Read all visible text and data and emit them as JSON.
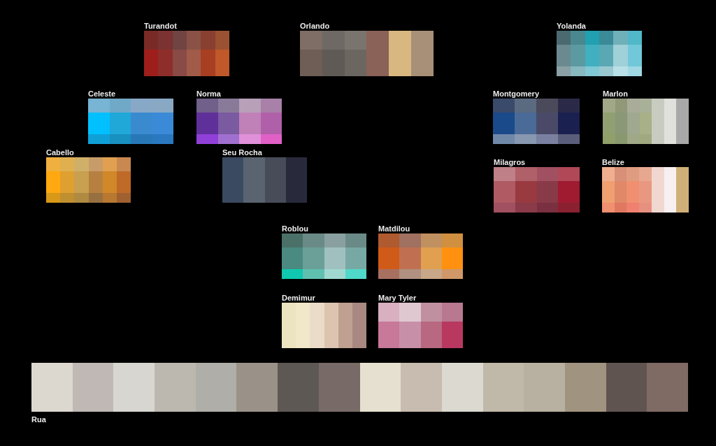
{
  "palettes": [
    {
      "name": "Turandot",
      "columns": [
        {
          "cells": [
            {
              "color": "#7a2a26"
            },
            {
              "color": "#9e1e1c"
            }
          ]
        },
        {
          "cells": [
            {
              "color": "#7c3230"
            },
            {
              "color": "#8e2e2a"
            }
          ]
        },
        {
          "cells": [
            {
              "color": "#6f4442"
            },
            {
              "color": "#8a4a46"
            }
          ]
        },
        {
          "cells": [
            {
              "color": "#8a5246"
            },
            {
              "color": "#a05c48"
            }
          ]
        },
        {
          "cells": [
            {
              "color": "#8a4030"
            },
            {
              "color": "#a83e22"
            }
          ]
        },
        {
          "cells": [
            {
              "color": "#9a5232"
            },
            {
              "color": "#c0582a"
            }
          ]
        }
      ]
    },
    {
      "name": "Orlando",
      "columns": [
        {
          "cells": [
            {
              "color": "#7e6e66"
            },
            {
              "color": "#6e5e56"
            }
          ]
        },
        {
          "cells": [
            {
              "color": "#6e6964"
            },
            {
              "color": "#5f5a56"
            }
          ]
        },
        {
          "cells": [
            {
              "color": "#7a746f"
            },
            {
              "color": "#6c6661"
            }
          ]
        },
        {
          "cells": [
            {
              "color": "#8a6258"
            }
          ]
        },
        {
          "cells": [
            {
              "color": "#d8b880"
            }
          ]
        },
        {
          "cells": [
            {
              "color": "#a89078"
            }
          ]
        }
      ]
    },
    {
      "name": "Yolanda",
      "columns": [
        {
          "cells": [
            {
              "color": "#4a6a70"
            },
            {
              "color": "#6a8a90"
            },
            {
              "color": "#8aa0a4"
            }
          ]
        },
        {
          "cells": [
            {
              "color": "#4a8890"
            },
            {
              "color": "#5a9aa0"
            },
            {
              "color": "#88b8c0"
            }
          ]
        },
        {
          "cells": [
            {
              "color": "#20a0b0"
            },
            {
              "color": "#40b0c0"
            },
            {
              "color": "#80c8d4"
            }
          ]
        },
        {
          "cells": [
            {
              "color": "#3a8a98"
            },
            {
              "color": "#5aa8b4"
            },
            {
              "color": "#9ac8d0"
            }
          ]
        },
        {
          "cells": [
            {
              "color": "#70b0b8"
            },
            {
              "color": "#a0d0d8"
            },
            {
              "color": "#b8e0e6"
            }
          ]
        },
        {
          "cells": [
            {
              "color": "#50b8c8"
            },
            {
              "color": "#70c8d8"
            },
            {
              "color": "#a0d8e4"
            }
          ]
        }
      ]
    },
    {
      "name": "Celeste",
      "columns": [
        {
          "cells": [
            {
              "color": "#78b4d4"
            },
            {
              "color": "#00c0ff"
            },
            {
              "color": "#10a0d8"
            }
          ]
        },
        {
          "cells": [
            {
              "color": "#70a8c8"
            },
            {
              "color": "#20a8d8"
            },
            {
              "color": "#1890c0"
            }
          ]
        },
        {
          "cells": [
            {
              "color": "#88a8c8"
            },
            {
              "color": "#3a8ad0"
            },
            {
              "color": "#2878b8"
            }
          ]
        },
        {
          "cells": [
            {
              "color": "#88a8c4"
            },
            {
              "color": "#3a8ad8"
            },
            {
              "color": "#2a78c0"
            }
          ]
        }
      ]
    },
    {
      "name": "Norma",
      "columns": [
        {
          "cells": [
            {
              "color": "#70608a"
            },
            {
              "color": "#60309a"
            },
            {
              "color": "#9040d8"
            }
          ]
        },
        {
          "cells": [
            {
              "color": "#8a7a9a"
            },
            {
              "color": "#7a5aa0"
            },
            {
              "color": "#a070d0"
            }
          ]
        },
        {
          "cells": [
            {
              "color": "#b8a0b8"
            },
            {
              "color": "#c080b8"
            },
            {
              "color": "#e090d8"
            }
          ]
        },
        {
          "cells": [
            {
              "color": "#a880a8"
            },
            {
              "color": "#b060a8"
            },
            {
              "color": "#e060c8"
            }
          ]
        }
      ]
    },
    {
      "name": "Montgomery",
      "columns": [
        {
          "cells": [
            {
              "color": "#3a4a6a"
            },
            {
              "color": "#1a4a8a"
            },
            {
              "color": "#7088a8"
            }
          ]
        },
        {
          "cells": [
            {
              "color": "#5a6a80"
            },
            {
              "color": "#4a6a98"
            },
            {
              "color": "#8898b0"
            }
          ]
        },
        {
          "cells": [
            {
              "color": "#4a4a5a"
            },
            {
              "color": "#4a4a68"
            },
            {
              "color": "#7a80a0"
            }
          ]
        },
        {
          "cells": [
            {
              "color": "#2a2a48"
            },
            {
              "color": "#1a2050"
            },
            {
              "color": "#5a5e7a"
            }
          ]
        }
      ]
    },
    {
      "name": "Marlon",
      "columns": [
        {
          "cells": [
            {
              "color": "#a0a888"
            },
            {
              "color": "#90a070"
            },
            {
              "color": "#90a068"
            }
          ]
        },
        {
          "cells": [
            {
              "color": "#909878"
            },
            {
              "color": "#8a9878"
            },
            {
              "color": "#8a9870"
            }
          ]
        },
        {
          "cells": [
            {
              "color": "#a8ac98"
            },
            {
              "color": "#a0a890"
            },
            {
              "color": "#a0a888"
            }
          ]
        },
        {
          "cells": [
            {
              "color": "#a8b098"
            },
            {
              "color": "#a8b088"
            },
            {
              "color": "#a0a880"
            }
          ]
        },
        {
          "cells": [
            {
              "color": "#c8ccc0"
            }
          ]
        },
        {
          "cells": [
            {
              "color": "#e0e0dc"
            }
          ]
        },
        {
          "cells": [
            {
              "color": "#a8a8a8"
            }
          ]
        }
      ]
    },
    {
      "name": "Cabello",
      "columns": [
        {
          "cells": [
            {
              "color": "#f0b040"
            },
            {
              "color": "#ffa810"
            },
            {
              "color": "#d89818"
            }
          ]
        },
        {
          "cells": [
            {
              "color": "#e0b050"
            },
            {
              "color": "#e0a030"
            },
            {
              "color": "#c09030"
            }
          ]
        },
        {
          "cells": [
            {
              "color": "#d0b068"
            },
            {
              "color": "#c8a050"
            },
            {
              "color": "#b08a40"
            }
          ]
        },
        {
          "cells": [
            {
              "color": "#c89c68"
            },
            {
              "color": "#b88040"
            },
            {
              "color": "#987040"
            }
          ]
        },
        {
          "cells": [
            {
              "color": "#e0a050"
            },
            {
              "color": "#d08828"
            },
            {
              "color": "#b87830"
            }
          ]
        },
        {
          "cells": [
            {
              "color": "#c88850"
            },
            {
              "color": "#c06a28"
            },
            {
              "color": "#a06030"
            }
          ]
        }
      ]
    },
    {
      "name": "Seu Rocha",
      "columns": [
        {
          "cells": [
            {
              "color": "#3a4a60"
            }
          ]
        },
        {
          "cells": [
            {
              "color": "#5a6470"
            }
          ]
        },
        {
          "cells": [
            {
              "color": "#484c58"
            }
          ]
        },
        {
          "cells": [
            {
              "color": "#282a3c"
            }
          ]
        }
      ]
    },
    {
      "name": "Milagros",
      "columns": [
        {
          "cells": [
            {
              "color": "#c08088"
            },
            {
              "color": "#b05a64"
            },
            {
              "color": "#a05060"
            }
          ]
        },
        {
          "cells": [
            {
              "color": "#b06068"
            },
            {
              "color": "#983a40"
            },
            {
              "color": "#8a3a48"
            }
          ]
        },
        {
          "cells": [
            {
              "color": "#a05060"
            },
            {
              "color": "#883a48"
            },
            {
              "color": "#7a3040"
            }
          ]
        },
        {
          "cells": [
            {
              "color": "#b04858"
            },
            {
              "color": "#a01a30"
            },
            {
              "color": "#8a2030"
            }
          ]
        }
      ]
    },
    {
      "name": "Belize",
      "columns": [
        {
          "cells": [
            {
              "color": "#f0b090"
            },
            {
              "color": "#f0a070"
            },
            {
              "color": "#f09070"
            }
          ]
        },
        {
          "cells": [
            {
              "color": "#d89078"
            },
            {
              "color": "#e08868"
            },
            {
              "color": "#e07860"
            }
          ]
        },
        {
          "cells": [
            {
              "color": "#e09c80"
            },
            {
              "color": "#f09070"
            },
            {
              "color": "#f08070"
            }
          ]
        },
        {
          "cells": [
            {
              "color": "#e8a890"
            },
            {
              "color": "#e89880"
            },
            {
              "color": "#e89080"
            }
          ]
        },
        {
          "cells": [
            {
              "color": "#f0d8d0"
            }
          ]
        },
        {
          "cells": [
            {
              "color": "#f8f0f0"
            }
          ]
        },
        {
          "cells": [
            {
              "color": "#d0b078"
            }
          ]
        }
      ]
    },
    {
      "name": "Roblou",
      "columns": [
        {
          "cells": [
            {
              "color": "#4a7068"
            },
            {
              "color": "#4a8a80"
            },
            {
              "color": "#10c8b0"
            }
          ]
        },
        {
          "cells": [
            {
              "color": "#6a8a88"
            },
            {
              "color": "#6aa098"
            },
            {
              "color": "#60c0b0"
            }
          ]
        },
        {
          "cells": [
            {
              "color": "#8aa0a0"
            },
            {
              "color": "#a0c0c0"
            },
            {
              "color": "#a0d8d0"
            }
          ]
        },
        {
          "cells": [
            {
              "color": "#6a8a88"
            },
            {
              "color": "#78a8a4"
            },
            {
              "color": "#50d8c8"
            }
          ]
        }
      ]
    },
    {
      "name": "Matdilou",
      "columns": [
        {
          "cells": [
            {
              "color": "#b05a30"
            },
            {
              "color": "#d05a18"
            },
            {
              "color": "#a87060"
            }
          ]
        },
        {
          "cells": [
            {
              "color": "#a07060"
            },
            {
              "color": "#c07050"
            },
            {
              "color": "#b09080"
            }
          ]
        },
        {
          "cells": [
            {
              "color": "#c09060"
            },
            {
              "color": "#e0a050"
            },
            {
              "color": "#c8a888"
            }
          ]
        },
        {
          "cells": [
            {
              "color": "#d09040"
            },
            {
              "color": "#ff9010"
            },
            {
              "color": "#d09868"
            }
          ]
        }
      ]
    },
    {
      "name": "Demimur",
      "columns": [
        {
          "cells": [
            {
              "color": "#ece4c0"
            }
          ]
        },
        {
          "cells": [
            {
              "color": "#f0e8c8"
            }
          ]
        },
        {
          "cells": [
            {
              "color": "#eadcc8"
            }
          ]
        },
        {
          "cells": [
            {
              "color": "#dcc4b0"
            }
          ]
        },
        {
          "cells": [
            {
              "color": "#c0a090"
            }
          ]
        },
        {
          "cells": [
            {
              "color": "#a88880"
            }
          ]
        }
      ]
    },
    {
      "name": "Mary Tyler",
      "columns": [
        {
          "cells": [
            {
              "color": "#d8b0c0"
            },
            {
              "color": "#c87898"
            }
          ]
        },
        {
          "cells": [
            {
              "color": "#e0c8d0"
            },
            {
              "color": "#c890a8"
            }
          ]
        },
        {
          "cells": [
            {
              "color": "#c090a0"
            },
            {
              "color": "#b86880"
            }
          ]
        },
        {
          "cells": [
            {
              "color": "#b87890"
            },
            {
              "color": "#b83860"
            }
          ]
        }
      ]
    },
    {
      "name": "Rua",
      "kind": "strip",
      "columns": [
        {
          "cells": [
            {
              "color": "#dcd8d0"
            }
          ]
        },
        {
          "cells": [
            {
              "color": "#c0b8b4"
            }
          ]
        },
        {
          "cells": [
            {
              "color": "#d8d6d0"
            }
          ]
        },
        {
          "cells": [
            {
              "color": "#bcb8b0"
            }
          ]
        },
        {
          "cells": [
            {
              "color": "#b0aea8"
            }
          ]
        },
        {
          "cells": [
            {
              "color": "#9a9288"
            }
          ]
        },
        {
          "cells": [
            {
              "color": "#5e5854"
            }
          ]
        },
        {
          "cells": [
            {
              "color": "#786a66"
            }
          ]
        },
        {
          "cells": [
            {
              "color": "#e6e0d0"
            }
          ]
        },
        {
          "cells": [
            {
              "color": "#c8bcb0"
            }
          ]
        },
        {
          "cells": [
            {
              "color": "#dcdad0"
            }
          ]
        },
        {
          "cells": [
            {
              "color": "#c0b8a8"
            }
          ]
        },
        {
          "cells": [
            {
              "color": "#b8b0a0"
            }
          ]
        },
        {
          "cells": [
            {
              "color": "#a09480"
            }
          ]
        },
        {
          "cells": [
            {
              "color": "#605450"
            }
          ]
        },
        {
          "cells": [
            {
              "color": "#806a64"
            }
          ]
        }
      ]
    }
  ]
}
